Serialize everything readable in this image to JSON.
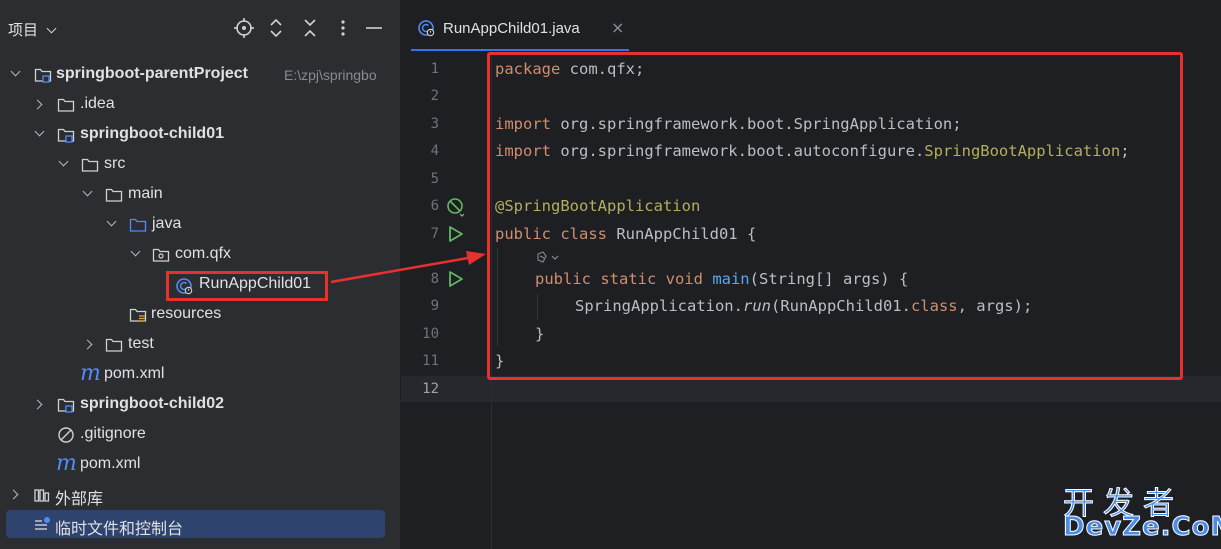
{
  "project_pane": {
    "title": "项目",
    "header_icons": [
      "target-icon",
      "expand-collapse-icon",
      "collapse-all-icon",
      "more-vertical-icon",
      "minimize-icon"
    ],
    "tree": [
      {
        "label": "springboot-parentProject",
        "hint": "E:\\zpj\\springbo",
        "icon": "module-folder-icon",
        "expanded": true,
        "bold": true
      },
      {
        "label": ".idea",
        "icon": "folder-icon",
        "expanded": false
      },
      {
        "label": "springboot-child01",
        "icon": "module-folder-icon",
        "expanded": true,
        "bold": true
      },
      {
        "label": "src",
        "icon": "folder-icon",
        "expanded": true
      },
      {
        "label": "main",
        "icon": "folder-icon",
        "expanded": true
      },
      {
        "label": "java",
        "icon": "source-folder-icon",
        "expanded": true
      },
      {
        "label": "com.qfx",
        "icon": "package-icon",
        "expanded": true
      },
      {
        "label": "RunAppChild01",
        "icon": "spring-boot-class-icon"
      },
      {
        "label": "resources",
        "icon": "resources-folder-icon"
      },
      {
        "label": "test",
        "icon": "folder-icon",
        "expanded": false
      },
      {
        "label": "pom.xml",
        "icon": "maven-icon"
      },
      {
        "label": "springboot-child02",
        "icon": "module-folder-icon",
        "expanded": false,
        "bold": true
      },
      {
        "label": ".gitignore",
        "icon": "ignore-file-icon"
      },
      {
        "label": "pom.xml",
        "icon": "maven-icon"
      },
      {
        "label": "外部库",
        "icon": "library-icon",
        "expanded": false
      },
      {
        "label": "临时文件和控制台",
        "icon": "scratches-icon",
        "selected": true
      }
    ]
  },
  "editor": {
    "tab": {
      "label": "RunAppChild01.java",
      "close": "×",
      "icon": "spring-boot-class-icon"
    },
    "line_numbers": [
      "1",
      "2",
      "3",
      "4",
      "5",
      "6",
      "7",
      "8",
      "9",
      "10",
      "11",
      "12"
    ],
    "code": {
      "l1_kw": "package",
      "l1_rest": " com.qfx;",
      "l3_kw": "import",
      "l3_rest": " org.springframework.boot.SpringApplication;",
      "l4_kw": "import",
      "l4_rest": " org.springframework.boot.autoconfigure.",
      "l4_cls": "SpringBootApplication",
      "l4_end": ";",
      "l6_ann": "@SpringBootApplication",
      "l7_kw": "public class",
      "l7_rest": " RunAppChild01 {",
      "l8_kw": "public static void",
      "l8_fn": " main",
      "l8_rest": "(String[] args) {",
      "l9_a": "SpringApplication.",
      "l9_run": "run",
      "l9_b": "(RunAppChild01.",
      "l9_kw": "class",
      "l9_c": ", args);",
      "l10": "}",
      "l11": "}"
    },
    "gutter_icons": {
      "line6": "spring-bean-icon",
      "line7": "run-icon",
      "line8": "run-icon"
    }
  },
  "watermark": {
    "cn": "开发者",
    "en": "DevZe.CoM"
  },
  "colors": {
    "accent": "#3574f0",
    "annotation_red": "#e8312f",
    "selection": "#2e436e"
  }
}
